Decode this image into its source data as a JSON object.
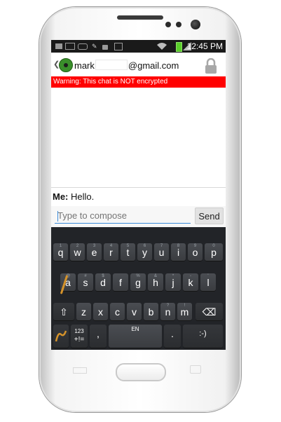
{
  "status_bar": {
    "time": "12:45 PM",
    "icons": [
      "sd-card-icon",
      "image-icon",
      "voicemail-icon",
      "usb-icon",
      "lock-icon",
      "play-store-icon",
      "wifi-icon",
      "battery-charging-icon",
      "signal-icon"
    ]
  },
  "header": {
    "back_glyph": "❮",
    "contact_prefix": "mark",
    "contact_suffix": "@gmail.com"
  },
  "warning": {
    "text": "Warning: This chat is NOT encrypted",
    "color": "#ff0000"
  },
  "conversation": {
    "messages": [
      {
        "sender": "Me:",
        "text": "Hello."
      }
    ]
  },
  "compose": {
    "placeholder": "Type to compose",
    "send_label": "Send"
  },
  "keyboard": {
    "row1": [
      "q",
      "w",
      "e",
      "r",
      "t",
      "y",
      "u",
      "i",
      "o",
      "p"
    ],
    "row1_hints": [
      "1",
      "2",
      "3",
      "4",
      "5",
      "6",
      "7",
      "8",
      "9",
      "0"
    ],
    "row2": [
      "a",
      "s",
      "d",
      "f",
      "g",
      "h",
      "j",
      "k",
      "l"
    ],
    "row2_hints": [
      "@",
      "#",
      "$",
      "",
      "%",
      "&",
      "*",
      "-",
      "'"
    ],
    "row3": [
      "z",
      "x",
      "c",
      "v",
      "b",
      "n",
      "m"
    ],
    "row3_hints": [
      "",
      "",
      "",
      "",
      "",
      "?",
      "!"
    ],
    "row3_hints_fill": [
      "\"",
      "!",
      "?",
      "",
      ""
    ],
    "symbols_top": "123",
    "symbols_bottom": "+!=",
    "comma": ",",
    "language": "EN",
    "period": ".",
    "smiley": ":-)",
    "shift_glyph": "⇧",
    "backspace_glyph": "⌫",
    "accent_color": "#d6932a"
  }
}
